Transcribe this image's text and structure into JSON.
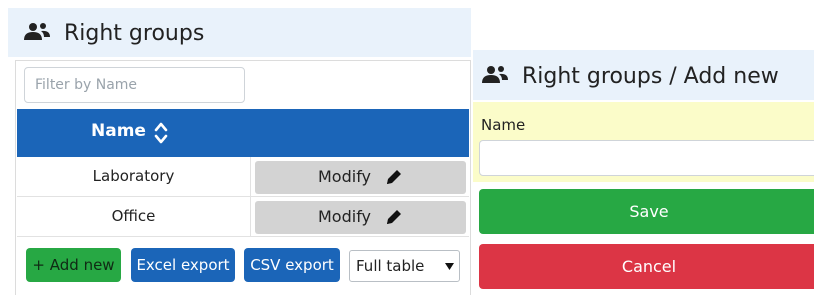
{
  "list_panel": {
    "title": "Right groups",
    "icon": "users-icon",
    "filter": {
      "placeholder": "Filter by Name",
      "value": ""
    },
    "table": {
      "header_bg": "#1b65b8",
      "columns": [
        {
          "label": "Name",
          "sort_icon": "sort-icon"
        }
      ],
      "rows": [
        {
          "name": "Laboratory",
          "action": "Modify",
          "action_icon": "pencil-icon"
        },
        {
          "name": "Office",
          "action": "Modify",
          "action_icon": "pencil-icon"
        }
      ]
    },
    "toolbar": {
      "add_label": "+ Add new",
      "excel_label": "Excel export",
      "csv_label": "CSV export",
      "select_value": "Full table"
    }
  },
  "form_panel": {
    "title": "Right groups / Add new",
    "icon": "users-icon",
    "field_label": "Name",
    "field_value": "",
    "save_label": "Save",
    "cancel_label": "Cancel"
  },
  "colors": {
    "header_bg": "#e9f2fb",
    "primary": "#1b65b8",
    "success": "#27a844",
    "danger": "#dc3545",
    "field_highlight": "#fbfcc9",
    "modify_button": "#d3d3d3"
  }
}
